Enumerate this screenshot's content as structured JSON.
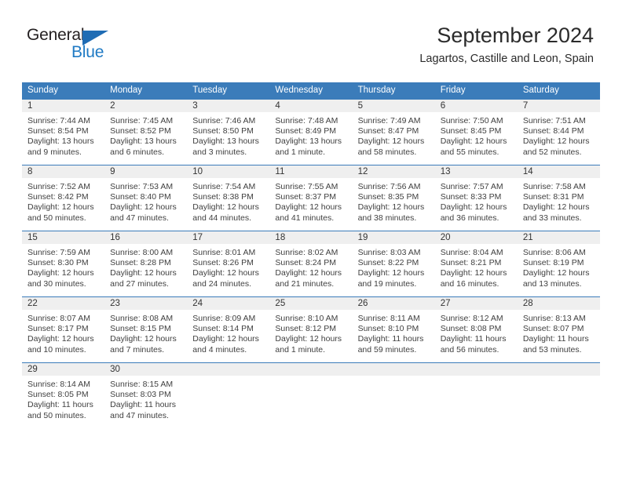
{
  "brand": {
    "name_part1": "General",
    "name_part2": "Blue",
    "accent_color": "#1f7ac4",
    "triangle_color": "#1f6cb4"
  },
  "header": {
    "month_title": "September 2024",
    "location": "Lagartos, Castille and Leon, Spain"
  },
  "calendar": {
    "header_bg": "#3b7cba",
    "daynum_bg": "#efefef",
    "weekday_headers": [
      "Sunday",
      "Monday",
      "Tuesday",
      "Wednesday",
      "Thursday",
      "Friday",
      "Saturday"
    ],
    "weeks": [
      [
        {
          "day": "1",
          "sunrise": "Sunrise: 7:44 AM",
          "sunset": "Sunset: 8:54 PM",
          "daylight_1": "Daylight: 13 hours",
          "daylight_2": "and 9 minutes."
        },
        {
          "day": "2",
          "sunrise": "Sunrise: 7:45 AM",
          "sunset": "Sunset: 8:52 PM",
          "daylight_1": "Daylight: 13 hours",
          "daylight_2": "and 6 minutes."
        },
        {
          "day": "3",
          "sunrise": "Sunrise: 7:46 AM",
          "sunset": "Sunset: 8:50 PM",
          "daylight_1": "Daylight: 13 hours",
          "daylight_2": "and 3 minutes."
        },
        {
          "day": "4",
          "sunrise": "Sunrise: 7:48 AM",
          "sunset": "Sunset: 8:49 PM",
          "daylight_1": "Daylight: 13 hours",
          "daylight_2": "and 1 minute."
        },
        {
          "day": "5",
          "sunrise": "Sunrise: 7:49 AM",
          "sunset": "Sunset: 8:47 PM",
          "daylight_1": "Daylight: 12 hours",
          "daylight_2": "and 58 minutes."
        },
        {
          "day": "6",
          "sunrise": "Sunrise: 7:50 AM",
          "sunset": "Sunset: 8:45 PM",
          "daylight_1": "Daylight: 12 hours",
          "daylight_2": "and 55 minutes."
        },
        {
          "day": "7",
          "sunrise": "Sunrise: 7:51 AM",
          "sunset": "Sunset: 8:44 PM",
          "daylight_1": "Daylight: 12 hours",
          "daylight_2": "and 52 minutes."
        }
      ],
      [
        {
          "day": "8",
          "sunrise": "Sunrise: 7:52 AM",
          "sunset": "Sunset: 8:42 PM",
          "daylight_1": "Daylight: 12 hours",
          "daylight_2": "and 50 minutes."
        },
        {
          "day": "9",
          "sunrise": "Sunrise: 7:53 AM",
          "sunset": "Sunset: 8:40 PM",
          "daylight_1": "Daylight: 12 hours",
          "daylight_2": "and 47 minutes."
        },
        {
          "day": "10",
          "sunrise": "Sunrise: 7:54 AM",
          "sunset": "Sunset: 8:38 PM",
          "daylight_1": "Daylight: 12 hours",
          "daylight_2": "and 44 minutes."
        },
        {
          "day": "11",
          "sunrise": "Sunrise: 7:55 AM",
          "sunset": "Sunset: 8:37 PM",
          "daylight_1": "Daylight: 12 hours",
          "daylight_2": "and 41 minutes."
        },
        {
          "day": "12",
          "sunrise": "Sunrise: 7:56 AM",
          "sunset": "Sunset: 8:35 PM",
          "daylight_1": "Daylight: 12 hours",
          "daylight_2": "and 38 minutes."
        },
        {
          "day": "13",
          "sunrise": "Sunrise: 7:57 AM",
          "sunset": "Sunset: 8:33 PM",
          "daylight_1": "Daylight: 12 hours",
          "daylight_2": "and 36 minutes."
        },
        {
          "day": "14",
          "sunrise": "Sunrise: 7:58 AM",
          "sunset": "Sunset: 8:31 PM",
          "daylight_1": "Daylight: 12 hours",
          "daylight_2": "and 33 minutes."
        }
      ],
      [
        {
          "day": "15",
          "sunrise": "Sunrise: 7:59 AM",
          "sunset": "Sunset: 8:30 PM",
          "daylight_1": "Daylight: 12 hours",
          "daylight_2": "and 30 minutes."
        },
        {
          "day": "16",
          "sunrise": "Sunrise: 8:00 AM",
          "sunset": "Sunset: 8:28 PM",
          "daylight_1": "Daylight: 12 hours",
          "daylight_2": "and 27 minutes."
        },
        {
          "day": "17",
          "sunrise": "Sunrise: 8:01 AM",
          "sunset": "Sunset: 8:26 PM",
          "daylight_1": "Daylight: 12 hours",
          "daylight_2": "and 24 minutes."
        },
        {
          "day": "18",
          "sunrise": "Sunrise: 8:02 AM",
          "sunset": "Sunset: 8:24 PM",
          "daylight_1": "Daylight: 12 hours",
          "daylight_2": "and 21 minutes."
        },
        {
          "day": "19",
          "sunrise": "Sunrise: 8:03 AM",
          "sunset": "Sunset: 8:22 PM",
          "daylight_1": "Daylight: 12 hours",
          "daylight_2": "and 19 minutes."
        },
        {
          "day": "20",
          "sunrise": "Sunrise: 8:04 AM",
          "sunset": "Sunset: 8:21 PM",
          "daylight_1": "Daylight: 12 hours",
          "daylight_2": "and 16 minutes."
        },
        {
          "day": "21",
          "sunrise": "Sunrise: 8:06 AM",
          "sunset": "Sunset: 8:19 PM",
          "daylight_1": "Daylight: 12 hours",
          "daylight_2": "and 13 minutes."
        }
      ],
      [
        {
          "day": "22",
          "sunrise": "Sunrise: 8:07 AM",
          "sunset": "Sunset: 8:17 PM",
          "daylight_1": "Daylight: 12 hours",
          "daylight_2": "and 10 minutes."
        },
        {
          "day": "23",
          "sunrise": "Sunrise: 8:08 AM",
          "sunset": "Sunset: 8:15 PM",
          "daylight_1": "Daylight: 12 hours",
          "daylight_2": "and 7 minutes."
        },
        {
          "day": "24",
          "sunrise": "Sunrise: 8:09 AM",
          "sunset": "Sunset: 8:14 PM",
          "daylight_1": "Daylight: 12 hours",
          "daylight_2": "and 4 minutes."
        },
        {
          "day": "25",
          "sunrise": "Sunrise: 8:10 AM",
          "sunset": "Sunset: 8:12 PM",
          "daylight_1": "Daylight: 12 hours",
          "daylight_2": "and 1 minute."
        },
        {
          "day": "26",
          "sunrise": "Sunrise: 8:11 AM",
          "sunset": "Sunset: 8:10 PM",
          "daylight_1": "Daylight: 11 hours",
          "daylight_2": "and 59 minutes."
        },
        {
          "day": "27",
          "sunrise": "Sunrise: 8:12 AM",
          "sunset": "Sunset: 8:08 PM",
          "daylight_1": "Daylight: 11 hours",
          "daylight_2": "and 56 minutes."
        },
        {
          "day": "28",
          "sunrise": "Sunrise: 8:13 AM",
          "sunset": "Sunset: 8:07 PM",
          "daylight_1": "Daylight: 11 hours",
          "daylight_2": "and 53 minutes."
        }
      ],
      [
        {
          "day": "29",
          "sunrise": "Sunrise: 8:14 AM",
          "sunset": "Sunset: 8:05 PM",
          "daylight_1": "Daylight: 11 hours",
          "daylight_2": "and 50 minutes."
        },
        {
          "day": "30",
          "sunrise": "Sunrise: 8:15 AM",
          "sunset": "Sunset: 8:03 PM",
          "daylight_1": "Daylight: 11 hours",
          "daylight_2": "and 47 minutes."
        },
        {
          "day": "",
          "sunrise": "",
          "sunset": "",
          "daylight_1": "",
          "daylight_2": ""
        },
        {
          "day": "",
          "sunrise": "",
          "sunset": "",
          "daylight_1": "",
          "daylight_2": ""
        },
        {
          "day": "",
          "sunrise": "",
          "sunset": "",
          "daylight_1": "",
          "daylight_2": ""
        },
        {
          "day": "",
          "sunrise": "",
          "sunset": "",
          "daylight_1": "",
          "daylight_2": ""
        },
        {
          "day": "",
          "sunrise": "",
          "sunset": "",
          "daylight_1": "",
          "daylight_2": ""
        }
      ]
    ]
  }
}
